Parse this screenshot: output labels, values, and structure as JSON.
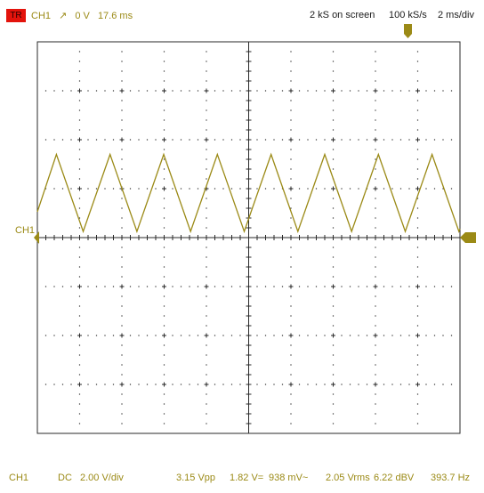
{
  "header": {
    "trigger_badge": "TR",
    "trigger_channel": "CH1",
    "trigger_slope_icon": "rising-edge-icon",
    "trigger_level": "0 V",
    "trigger_time": "17.6 ms",
    "samples_on_screen": "2 kS on screen",
    "sample_rate": "100 kS/s",
    "timebase": "2 ms/div"
  },
  "channel_marker": "CH1",
  "footer": {
    "channel": "CH1",
    "coupling": "DC",
    "vdiv": "2.00 V/div",
    "vpp": "3.15 Vpp",
    "vdc": "1.82 V=",
    "vac": "938 mV~",
    "vrms": "2.05 Vrms",
    "dbv": "6.22 dBV",
    "freq": "393.7 Hz"
  },
  "colors": {
    "trace": "#9b8a16",
    "badge": "#e3130c",
    "grid": "#2a2a2a"
  },
  "chart_data": {
    "type": "line",
    "waveform": "triangle",
    "x_unit": "ms",
    "y_unit": "V",
    "xlim": [
      0,
      20
    ],
    "ylim": [
      -8,
      8
    ],
    "x": [
      0,
      0.9,
      2.17,
      3.44,
      4.71,
      5.98,
      7.25,
      8.52,
      9.79,
      11.06,
      12.33,
      13.6,
      14.87,
      16.14,
      17.41,
      18.68,
      19.95,
      20
    ],
    "y": [
      1.05,
      3.4,
      0.25,
      3.4,
      0.25,
      3.4,
      0.25,
      3.4,
      0.25,
      3.4,
      0.25,
      3.4,
      0.25,
      3.4,
      0.25,
      3.4,
      0.25,
      0.36
    ],
    "grid": true
  }
}
